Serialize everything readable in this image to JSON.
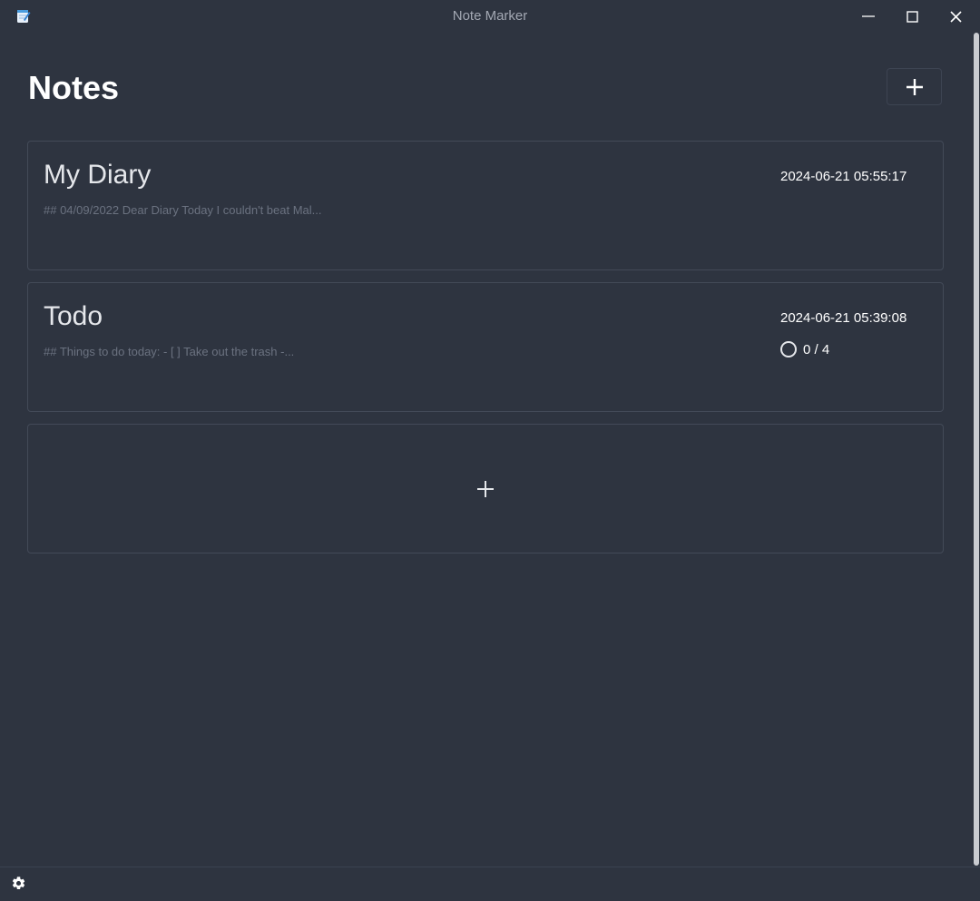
{
  "window": {
    "title": "Note Marker"
  },
  "header": {
    "title": "Notes"
  },
  "notes": [
    {
      "title": "My Diary",
      "date": "2024-06-21 05:55:17",
      "preview": "## 04/09/2022 Dear Diary Today I couldn't beat Mal..."
    },
    {
      "title": "Todo",
      "date": "2024-06-21 05:39:08",
      "preview": "## Things to do today: - [ ] Take out the trash -...",
      "todo_progress": "0 / 4"
    }
  ],
  "colors": {
    "background": "#2e3440",
    "card_border": "#434a58",
    "text_primary": "#ffffff",
    "text_muted": "#6b7280"
  },
  "icons": {
    "app": "notepad-icon",
    "minimize": "minimize-icon",
    "maximize": "maximize-icon",
    "close": "close-icon",
    "add": "plus-icon",
    "progress": "circle-icon",
    "settings": "gear-icon"
  }
}
